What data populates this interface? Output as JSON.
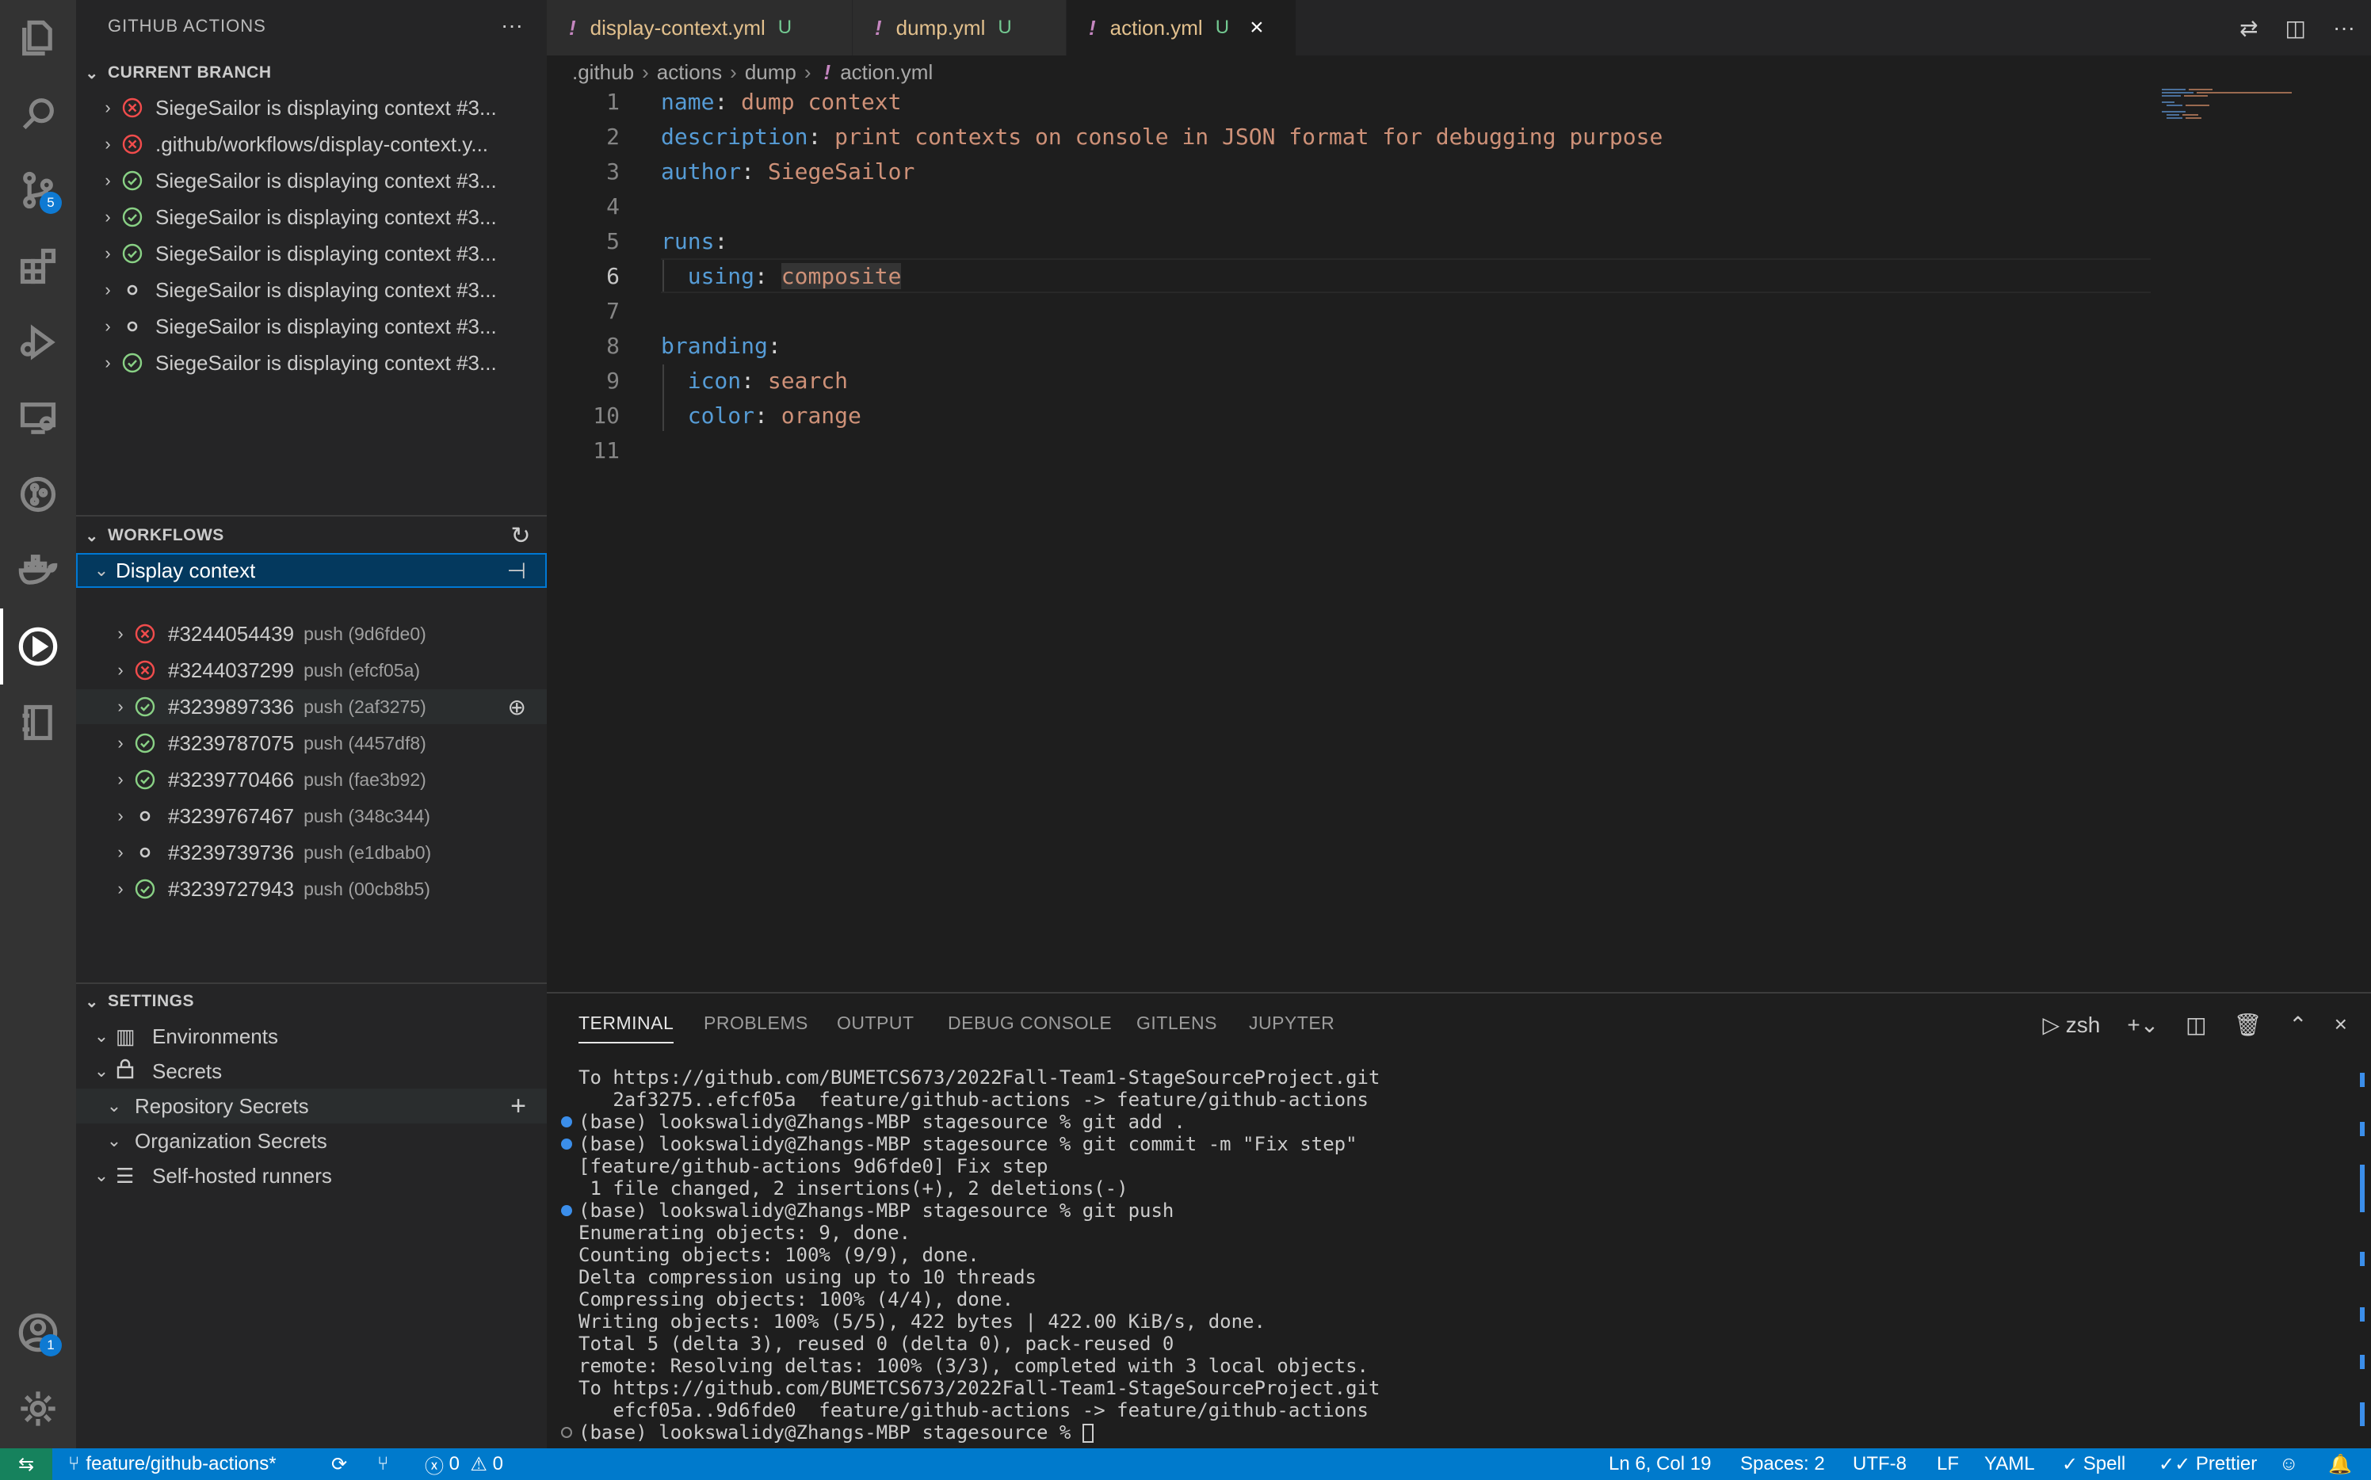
{
  "sidebar": {
    "title": "GITHUB ACTIONS",
    "current_branch": {
      "heading": "CURRENT BRANCH",
      "runs": [
        {
          "label": "SiegeSailor is displaying context #3...",
          "status": "failed"
        },
        {
          "label": ".github/workflows/display-context.y...",
          "status": "failed"
        },
        {
          "label": "SiegeSailor is displaying context #3...",
          "status": "success"
        },
        {
          "label": "SiegeSailor is displaying context #3...",
          "status": "success"
        },
        {
          "label": "SiegeSailor is displaying context #3...",
          "status": "success"
        },
        {
          "label": "SiegeSailor is displaying context #3...",
          "status": "pending"
        },
        {
          "label": "SiegeSailor is displaying context #3...",
          "status": "pending"
        },
        {
          "label": "SiegeSailor is displaying context #3...",
          "status": "success"
        }
      ]
    },
    "workflows": {
      "heading": "WORKFLOWS",
      "workflow_name": "Display context",
      "runs": [
        {
          "id": "#3244054439",
          "event": "push (9d6fde0)",
          "status": "failed"
        },
        {
          "id": "#3244037299",
          "event": "push (efcf05a)",
          "status": "failed"
        },
        {
          "id": "#3239897336",
          "event": "push (2af3275)",
          "status": "success"
        },
        {
          "id": "#3239787075",
          "event": "push (4457df8)",
          "status": "success"
        },
        {
          "id": "#3239770466",
          "event": "push (fae3b92)",
          "status": "success"
        },
        {
          "id": "#3239767467",
          "event": "push (348c344)",
          "status": "pending"
        },
        {
          "id": "#3239739736",
          "event": "push (e1dbab0)",
          "status": "pending"
        },
        {
          "id": "#3239727943",
          "event": "push (00cb8b5)",
          "status": "success"
        }
      ]
    },
    "settings": {
      "heading": "SETTINGS",
      "environments": "Environments",
      "secrets": "Secrets",
      "repository_secrets": "Repository Secrets",
      "organization_secrets": "Organization Secrets",
      "self_hosted_runners": "Self-hosted runners"
    }
  },
  "activity_badges": {
    "source_control": "5",
    "accounts": "1"
  },
  "tabs": [
    {
      "name": "display-context.yml",
      "modifier": "U"
    },
    {
      "name": "dump.yml",
      "modifier": "U"
    },
    {
      "name": "action.yml",
      "modifier": "U"
    }
  ],
  "breadcrumb": [
    ".github",
    "actions",
    "dump",
    "action.yml"
  ],
  "code": {
    "line_numbers": [
      "1",
      "2",
      "3",
      "4",
      "5",
      "6",
      "7",
      "8",
      "9",
      "10",
      "11"
    ],
    "l1_key": "name",
    "l1_val": "dump context",
    "l2_key": "description",
    "l2_val": "print contexts on console in JSON format for debugging purpose",
    "l3_key": "author",
    "l3_val": "SiegeSailor",
    "l5_key": "runs",
    "l6_key": "using",
    "l6_val": "composite",
    "l8_key": "branding",
    "l9_key": "icon",
    "l9_val": "search",
    "l10_key": "color",
    "l10_val": "orange"
  },
  "panel": {
    "tabs": [
      "TERMINAL",
      "PROBLEMS",
      "OUTPUT",
      "DEBUG CONSOLE",
      "GITLENS",
      "JUPYTER"
    ],
    "shell": "zsh",
    "lines": [
      "To https://github.com/BUMETCS673/2022Fall-Team1-StageSourceProject.git",
      "   2af3275..efcf05a  feature/github-actions -> feature/github-actions",
      "(base) lookswalidy@Zhangs-MBP stagesource % git add .",
      "(base) lookswalidy@Zhangs-MBP stagesource % git commit -m \"Fix step\"",
      "[feature/github-actions 9d6fde0] Fix step",
      " 1 file changed, 2 insertions(+), 2 deletions(-)",
      "(base) lookswalidy@Zhangs-MBP stagesource % git push",
      "Enumerating objects: 9, done.",
      "Counting objects: 100% (9/9), done.",
      "Delta compression using up to 10 threads",
      "Compressing objects: 100% (4/4), done.",
      "Writing objects: 100% (5/5), 422 bytes | 422.00 KiB/s, done.",
      "Total 5 (delta 3), reused 0 (delta 0), pack-reused 0",
      "remote: Resolving deltas: 100% (3/3), completed with 3 local objects.",
      "To https://github.com/BUMETCS673/2022Fall-Team1-StageSourceProject.git",
      "   efcf05a..9d6fde0  feature/github-actions -> feature/github-actions",
      "(base) lookswalidy@Zhangs-MBP stagesource % "
    ]
  },
  "status": {
    "branch": "feature/github-actions*",
    "errors": "0",
    "warnings": "0",
    "position": "Ln 6, Col 19",
    "spaces": "Spaces: 2",
    "encoding": "UTF-8",
    "eol": "LF",
    "language": "YAML",
    "spell": "Spell",
    "prettier": "Prettier"
  }
}
